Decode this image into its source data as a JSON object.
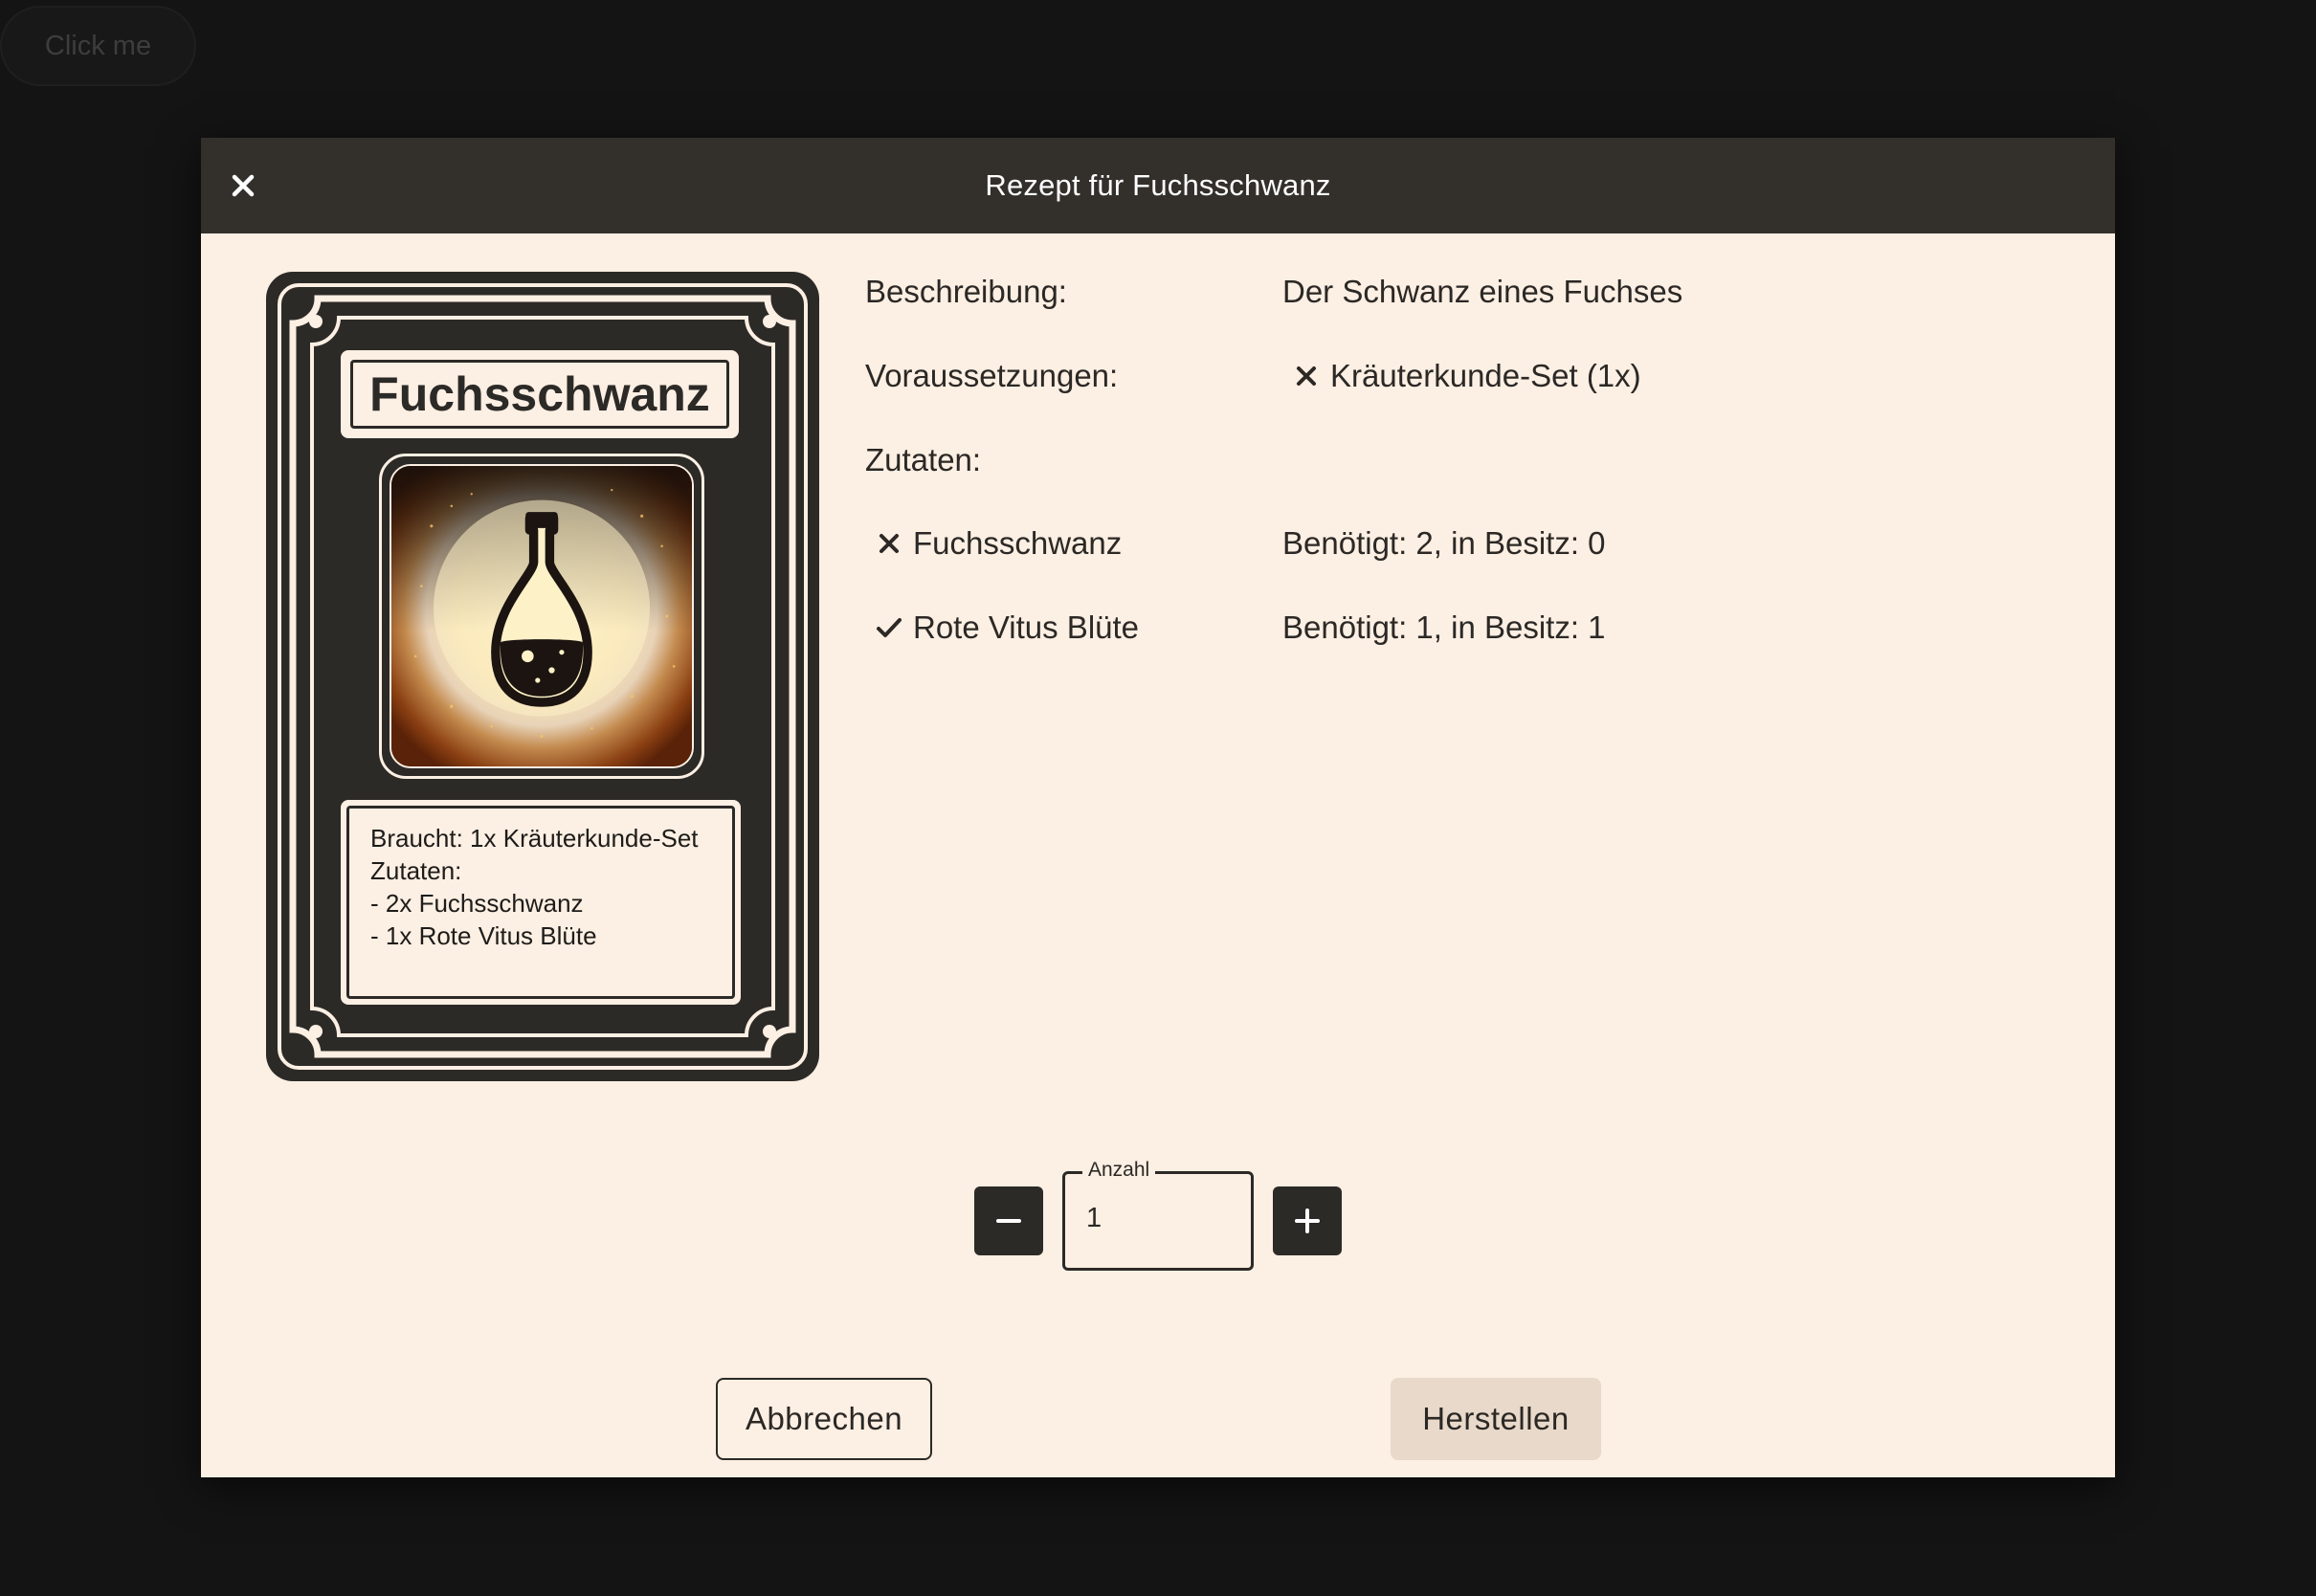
{
  "background": {
    "button_label": "Click me"
  },
  "dialog": {
    "title": "Rezept für Fuchsschwanz"
  },
  "card": {
    "title": "Fuchsschwanz",
    "lines": [
      "Braucht: 1x Kräuterkunde-Set",
      "Zutaten:",
      "- 2x Fuchsschwanz",
      "- 1x Rote Vitus Blüte"
    ]
  },
  "info": {
    "description_label": "Beschreibung:",
    "description_value": "Der Schwanz eines Fuchses",
    "requirements_label": "Voraussetzungen:",
    "requirement": {
      "name": "Kräuterkunde-Set (1x)",
      "met": false,
      "icon": "cross-icon"
    },
    "ingredients_label": "Zutaten:",
    "ingredients": [
      {
        "name": "Fuchsschwanz",
        "status": "Benötigt: 2, in Besitz: 0",
        "met": false,
        "icon": "cross-icon"
      },
      {
        "name": "Rote Vitus Blüte",
        "status": "Benötigt: 1, in Besitz: 1",
        "met": true,
        "icon": "check-icon"
      }
    ]
  },
  "quantity": {
    "label": "Anzahl",
    "value": "1",
    "decrement_icon": "minus-icon",
    "increment_icon": "plus-icon"
  },
  "actions": {
    "cancel_label": "Abbrechen",
    "create_label": "Herstellen"
  },
  "colors": {
    "dialog_bg": "#fcefe3",
    "header_bg": "#33302c",
    "dark": "#2c2a27",
    "create_bg": "#e8d9ca",
    "page_bg": "#141414"
  }
}
